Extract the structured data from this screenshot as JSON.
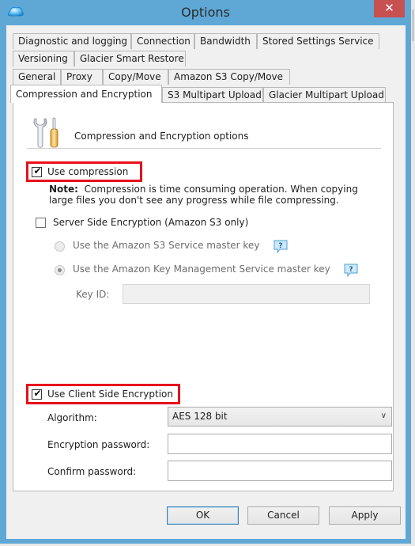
{
  "window": {
    "title": "Options",
    "close_label": "✕"
  },
  "tabs": {
    "row1": [
      {
        "label": "Diagnostic and logging"
      },
      {
        "label": "Connection"
      },
      {
        "label": "Bandwidth"
      },
      {
        "label": "Stored Settings Service"
      }
    ],
    "row2": [
      {
        "label": "Versioning"
      },
      {
        "label": "Glacier Smart Restore"
      }
    ],
    "row3": [
      {
        "label": "General"
      },
      {
        "label": "Proxy"
      },
      {
        "label": "Copy/Move"
      },
      {
        "label": "Amazon S3 Copy/Move"
      }
    ],
    "row4": [
      {
        "label": "Compression and Encryption",
        "active": true
      },
      {
        "label": "S3 Multipart Upload"
      },
      {
        "label": "Glacier Multipart Upload"
      }
    ]
  },
  "panel": {
    "header": "Compression and Encryption options",
    "use_compression": {
      "label": "Use compression",
      "checked": true
    },
    "note_bold": "Note:",
    "note_line1": "Compression is time consuming operation. When copying",
    "note_line2": "large files you don't see any progress while file compressing.",
    "server_side_encryption": {
      "label": "Server Side Encryption (Amazon S3 only)",
      "checked": false
    },
    "radio_s3_master_key": {
      "label": "Use the Amazon S3 Service master key",
      "selected": false,
      "enabled": false
    },
    "radio_kms_master_key": {
      "label": "Use the Amazon Key Management Service master key",
      "selected": true,
      "enabled": false
    },
    "key_id": {
      "label": "Key ID:",
      "value": ""
    },
    "client_side_encryption": {
      "label": "Use Client Side Encryption",
      "checked": true
    },
    "algorithm": {
      "label": "Algorithm:",
      "value": "AES 128 bit"
    },
    "encryption_password": {
      "label": "Encryption password:",
      "value": ""
    },
    "confirm_password": {
      "label": "Confirm password:",
      "value": ""
    }
  },
  "buttons": {
    "ok": "OK",
    "cancel": "Cancel",
    "apply": "Apply"
  },
  "colors": {
    "titlebar": "#5fa8d6",
    "close": "#c75050",
    "highlight_box": "#e8101c"
  }
}
